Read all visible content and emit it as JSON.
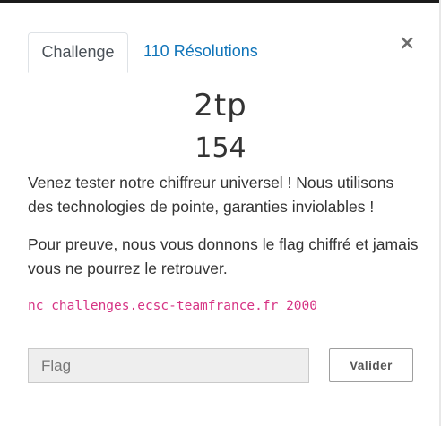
{
  "tabs": [
    {
      "label": "Challenge",
      "active": true
    },
    {
      "label": "110 Résolutions",
      "active": false
    }
  ],
  "close_symbol": "×",
  "challenge": {
    "name": "2tp",
    "points": "154",
    "description": [
      "Venez tester notre chiffreur universel ! Nous utilisons des technologies de pointe, garanties inviolables !",
      "Pour preuve, nous vous donnons le flag chiffré et jamais vous ne pourrez le retrouver."
    ],
    "connection": "nc challenges.ecsc-teamfrance.fr 2000"
  },
  "form": {
    "flag_placeholder": "Flag",
    "submit_label": "Valider"
  },
  "colors": {
    "accent": "#0f74b9",
    "code": "#d63384"
  }
}
